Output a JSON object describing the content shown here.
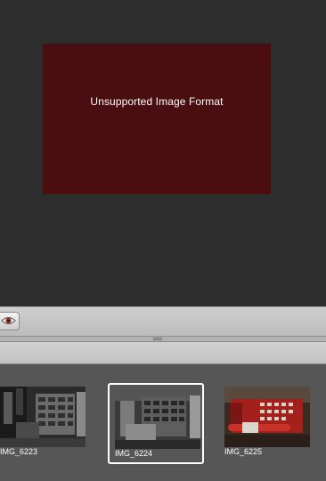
{
  "viewer": {
    "message": "Unsupported Image Format",
    "error_color": "#4a0d10"
  },
  "toolbar": {
    "preview_icon": "eye-icon"
  },
  "filmstrip": {
    "items": [
      {
        "label": "IMG_6223",
        "selected": false
      },
      {
        "label": "IMG_6224",
        "selected": true
      },
      {
        "label": "IMG_6225",
        "selected": false
      }
    ]
  }
}
